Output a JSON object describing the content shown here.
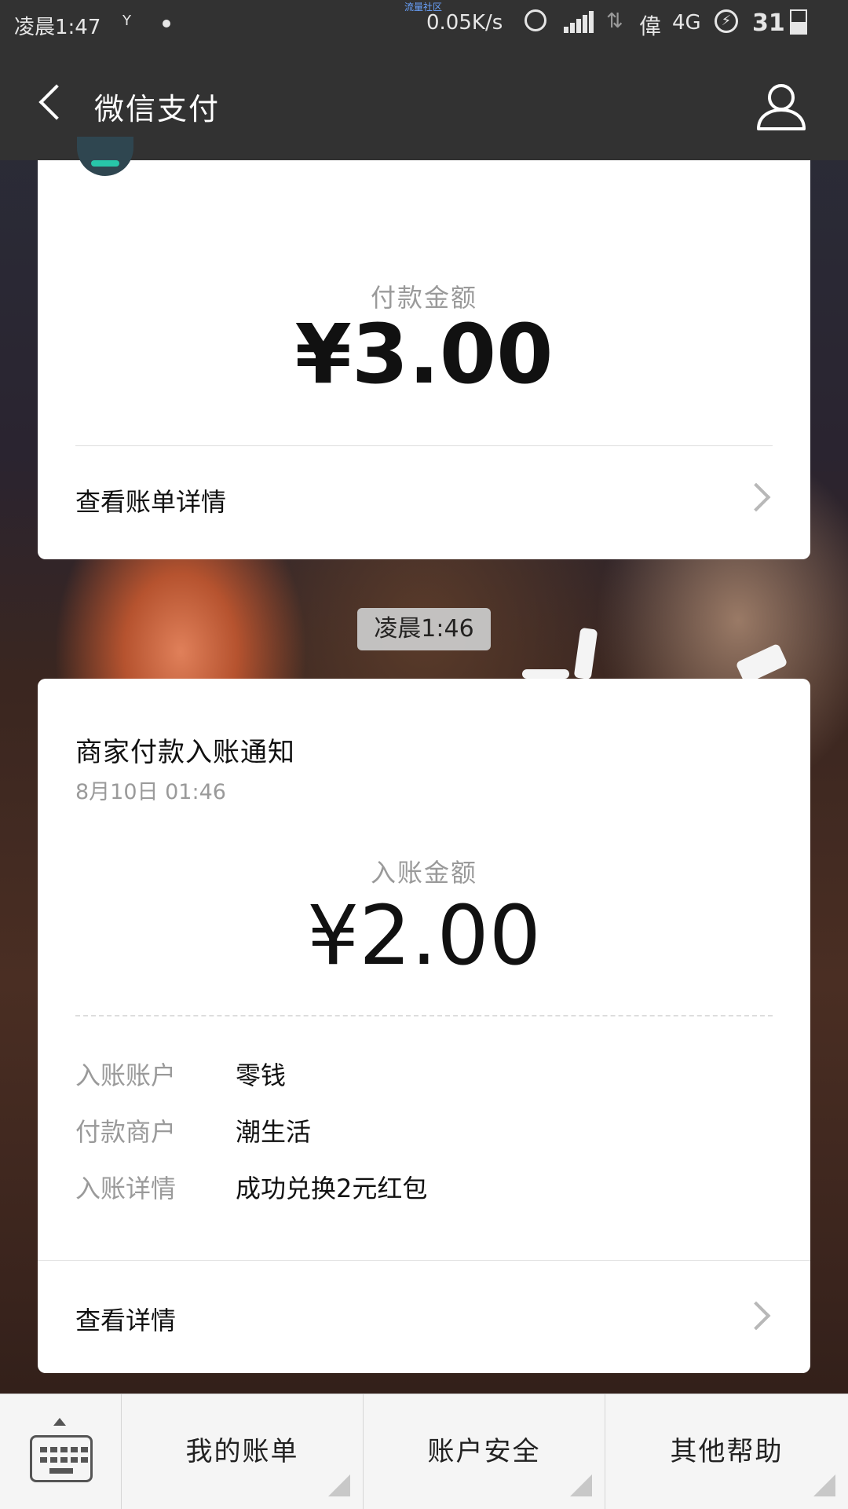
{
  "status_bar": {
    "time": "凌晨1:47",
    "network_tag": "流量社区",
    "speed": "0.05K/s",
    "carrier": "偉",
    "network_type": "4G",
    "battery": "31"
  },
  "nav": {
    "title": "微信支付"
  },
  "card_payment": {
    "amount_label": "付款金额",
    "amount": "¥3.00",
    "link_label": "查看账单详情"
  },
  "time_divider": "凌晨1:46",
  "card_notice": {
    "title": "商家付款入账通知",
    "date": "8月10日  01:46",
    "amount_label": "入账金额",
    "amount": "¥2.00",
    "details": [
      {
        "key": "入账账户",
        "value": "零钱"
      },
      {
        "key": "付款商户",
        "value": "潮生活"
      },
      {
        "key": "入账详情",
        "value": "成功兑换2元红包"
      }
    ],
    "link_label": "查看详情"
  },
  "bottom_menu": {
    "items": [
      {
        "label": "我的账单"
      },
      {
        "label": "账户安全"
      },
      {
        "label": "其他帮助"
      }
    ]
  }
}
